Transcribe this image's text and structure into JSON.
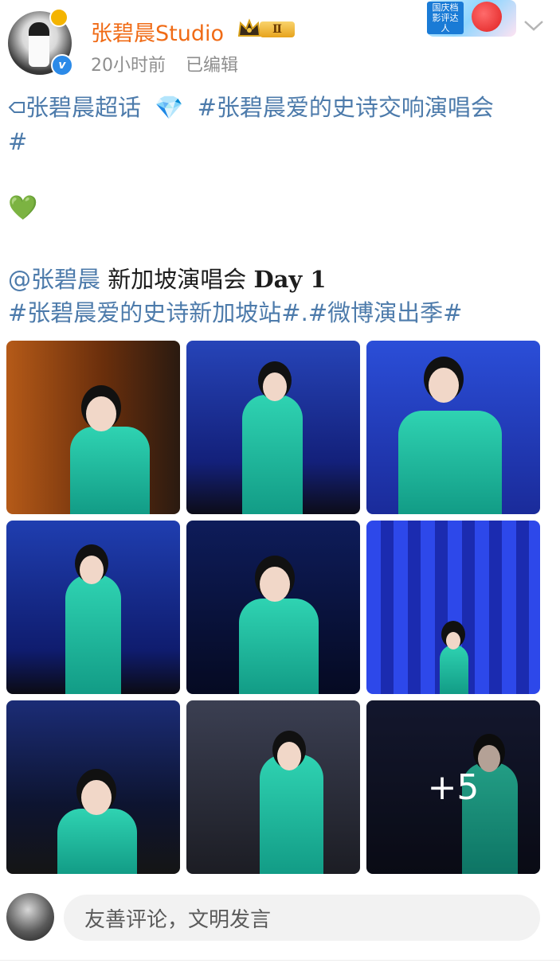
{
  "header": {
    "username": "张碧晨Studio",
    "level_badge": "Ⅱ",
    "time": "20小时前",
    "edited": "已编辑",
    "sticker_tag": "国庆档影评达人"
  },
  "post": {
    "topic_super": "张碧晨超话",
    "gem": "💎",
    "topic_tag": "#张碧晨爱的史诗交响演唱会",
    "topic_tag_end": "#",
    "heart": "💚",
    "mention": "@张碧晨",
    "mention_text": " 新加坡演唱会 ",
    "day": "Day 1",
    "tag_two": "#张碧晨爱的史诗新加坡站#",
    "dot": ".",
    "tag_three": "#微博演出季#"
  },
  "photos": {
    "more_count": "+5"
  },
  "comment": {
    "placeholder": "友善评论，文明发言"
  },
  "colors": {
    "username": "#f06b16",
    "link": "#4d7bab",
    "verified": "#2b8ae8"
  }
}
